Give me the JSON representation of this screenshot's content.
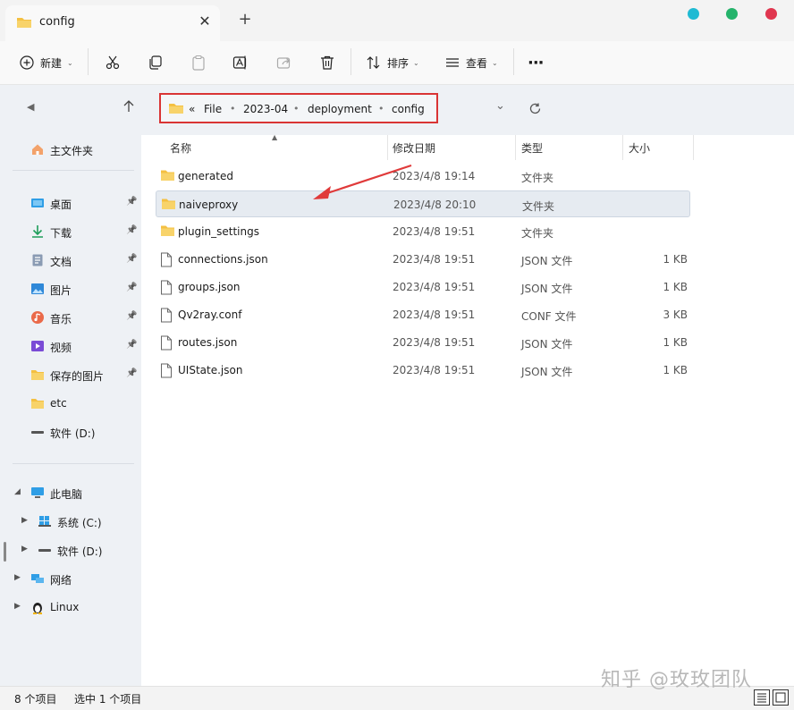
{
  "window": {
    "tab_title": "config",
    "tab_close": "✕",
    "new_tab": "+",
    "controls": [
      "#1fbad3",
      "#25b36b",
      "#e0364f"
    ]
  },
  "toolbar": {
    "new_label": "新建",
    "sort_label": "排序",
    "view_label": "查看",
    "more": "···"
  },
  "address": {
    "overflow": "«",
    "crumbs": [
      "File",
      "2023-04",
      "deployment",
      "config"
    ]
  },
  "sidebar": {
    "home": "主文件夹",
    "quick": [
      {
        "label": "桌面",
        "icon": "desktop-icon"
      },
      {
        "label": "下载",
        "icon": "download-icon"
      },
      {
        "label": "文档",
        "icon": "document-icon"
      },
      {
        "label": "图片",
        "icon": "pictures-icon"
      },
      {
        "label": "音乐",
        "icon": "music-icon"
      },
      {
        "label": "视频",
        "icon": "video-icon"
      },
      {
        "label": "保存的图片",
        "icon": "folder-icon"
      },
      {
        "label": "etc",
        "icon": "folder-icon"
      },
      {
        "label": "软件 (D:)",
        "icon": "drive-icon"
      }
    ],
    "this_pc": "此电脑",
    "drives": [
      "系统 (C:)",
      "软件 (D:)"
    ],
    "network": "网络",
    "linux": "Linux"
  },
  "columns": {
    "name": "名称",
    "date": "修改日期",
    "type": "类型",
    "size": "大小"
  },
  "files": [
    {
      "name": "generated",
      "date": "2023/4/8 19:14",
      "type": "文件夹",
      "size": "",
      "kind": "folder"
    },
    {
      "name": "naiveproxy",
      "date": "2023/4/8 20:10",
      "type": "文件夹",
      "size": "",
      "kind": "folder",
      "selected": true
    },
    {
      "name": "plugin_settings",
      "date": "2023/4/8 19:51",
      "type": "文件夹",
      "size": "",
      "kind": "folder"
    },
    {
      "name": "connections.json",
      "date": "2023/4/8 19:51",
      "type": "JSON 文件",
      "size": "1 KB",
      "kind": "file"
    },
    {
      "name": "groups.json",
      "date": "2023/4/8 19:51",
      "type": "JSON 文件",
      "size": "1 KB",
      "kind": "file"
    },
    {
      "name": "Qv2ray.conf",
      "date": "2023/4/8 19:51",
      "type": "CONF 文件",
      "size": "3 KB",
      "kind": "file"
    },
    {
      "name": "routes.json",
      "date": "2023/4/8 19:51",
      "type": "JSON 文件",
      "size": "1 KB",
      "kind": "file"
    },
    {
      "name": "UIState.json",
      "date": "2023/4/8 19:51",
      "type": "JSON 文件",
      "size": "1 KB",
      "kind": "file"
    }
  ],
  "status": {
    "count": "8 个项目",
    "selected": "选中 1 个项目"
  },
  "watermark": "知乎 @玫玫团队",
  "colors": {
    "highlight_box": "#d93434",
    "arrow": "#e03a3a",
    "folder": "#f4c042"
  }
}
